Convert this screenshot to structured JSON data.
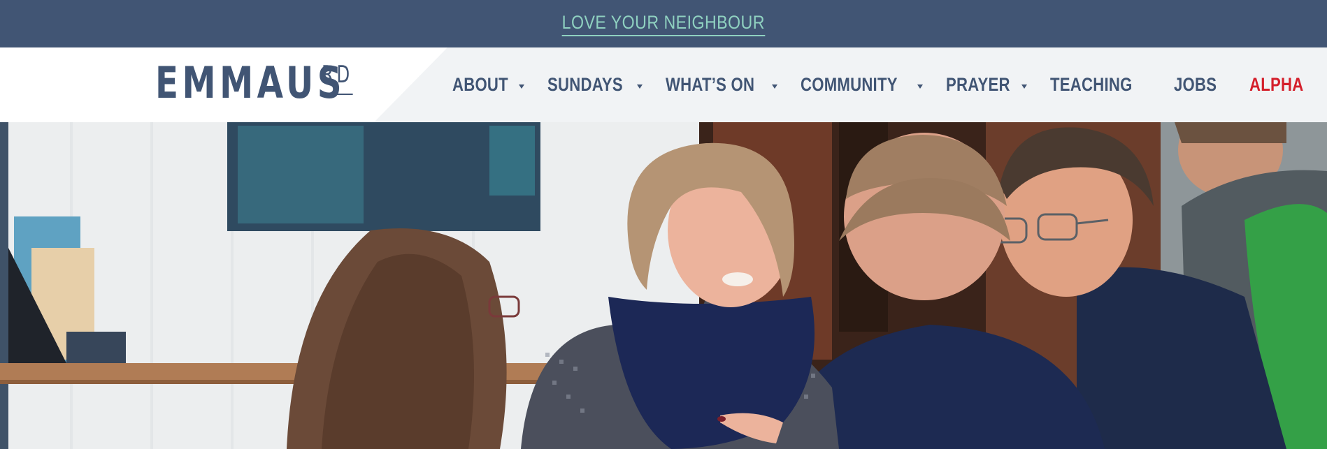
{
  "banner": {
    "text": "LOVE YOUR NEIGHBOUR"
  },
  "logo": {
    "main": "EMMAUS",
    "sub": "RD"
  },
  "nav": {
    "items": [
      {
        "label": "ABOUT",
        "dropdown": true
      },
      {
        "label": "SUNDAYS",
        "dropdown": true
      },
      {
        "label": "WHAT’S ON",
        "dropdown": true
      },
      {
        "label": "COMMUNITY",
        "dropdown": true
      },
      {
        "label": "PRAYER",
        "dropdown": true
      },
      {
        "label": "TEACHING",
        "dropdown": false
      },
      {
        "label": "JOBS",
        "dropdown": false
      },
      {
        "label": "ALPHA",
        "dropdown": false
      }
    ]
  },
  "colors": {
    "banner_bg": "#415574",
    "banner_link": "#8fd1c0",
    "nav_text": "#415574",
    "alpha": "#d41f2b"
  }
}
